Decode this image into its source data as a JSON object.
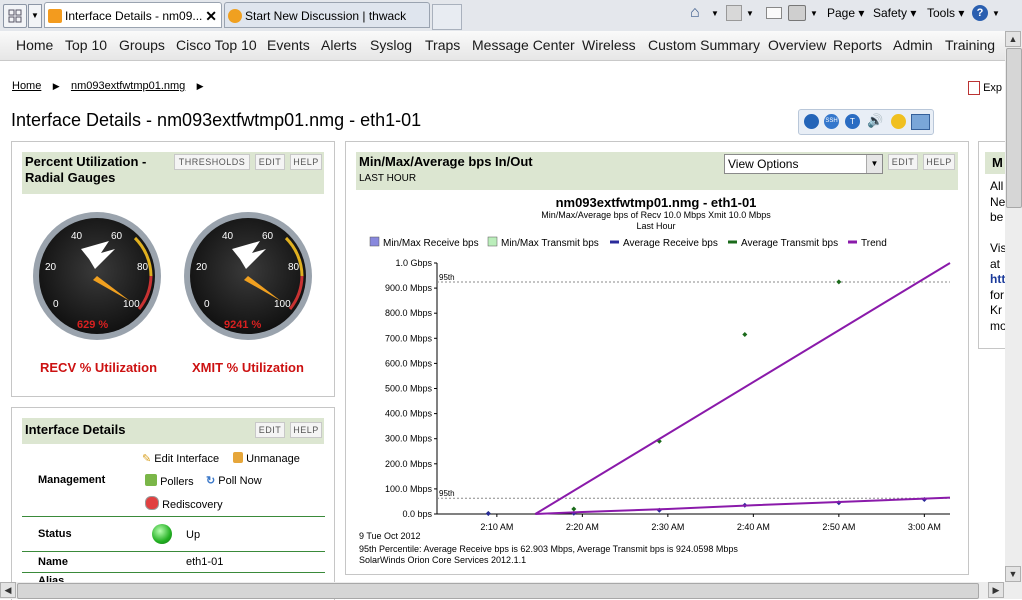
{
  "browser": {
    "tabs": [
      {
        "label": "Interface Details - nm09...",
        "active": true
      },
      {
        "label": "Start New Discussion | thwack",
        "active": false
      }
    ],
    "commands": {
      "page": "Page",
      "safety": "Safety",
      "tools": "Tools"
    }
  },
  "nav": {
    "items": [
      "Home",
      "Top 10",
      "Groups",
      "Cisco Top 10",
      "Events",
      "Alerts",
      "Syslog",
      "Traps",
      "Message Center",
      "Wireless",
      "Custom Summary",
      "Overview",
      "Reports",
      "Admin",
      "Training"
    ]
  },
  "breadcrumb": {
    "home": "Home",
    "node": "nm093extfwtmp01.nmg"
  },
  "export_label": "Exp",
  "page_title": "Interface Details - nm093extfwtmp01.nmg - eth1-01",
  "gauges_panel": {
    "title_line1": "Percent Utilization -",
    "title_line2": "Radial Gauges",
    "btn_thresholds": "THRESHOLDS",
    "btn_edit": "EDIT",
    "btn_help": "HELP",
    "ticks": [
      "0",
      "20",
      "40",
      "60",
      "80",
      "100"
    ],
    "recv": {
      "value_text": "629 %",
      "label": "RECV % Utilization",
      "percent": 629
    },
    "xmit": {
      "value_text": "9241 %",
      "label": "XMIT % Utilization",
      "percent": 9241
    }
  },
  "details_panel": {
    "title": "Interface Details",
    "btn_edit": "EDIT",
    "btn_help": "HELP",
    "management_label": "Management",
    "actions": {
      "edit": "Edit Interface",
      "unmanage": "Unmanage",
      "pollers": "Pollers",
      "poll_now": "Poll Now",
      "rediscovery": "Rediscovery"
    },
    "status_label": "Status",
    "status_value": "Up",
    "name_label": "Name",
    "name_value": "eth1-01",
    "alias_label": "Alias"
  },
  "chart_panel": {
    "title": "Min/Max/Average bps In/Out",
    "subtitle": "LAST HOUR",
    "view_options": "View Options",
    "btn_edit": "EDIT",
    "btn_help": "HELP",
    "chart_title": "nm093extfwtmp01.nmg - eth1-01",
    "chart_subtitle1": "Min/Max/Average bps of   Recv 10.0 Mbps  Xmit 10.0 Mbps",
    "chart_subtitle2": "Last Hour",
    "date_label": "9 Tue Oct 2012",
    "footer1": "95th Percentile: Average Receive bps is 62.903  Mbps, Average Transmit bps is 924.0598  Mbps",
    "footer2": "SolarWinds Orion Core Services 2012.1.1",
    "p95_label": "95th"
  },
  "right_panel": {
    "title": "M",
    "lines": [
      "All",
      "Ne",
      "be",
      "",
      "Vis",
      "at",
      "htt",
      "for",
      "Kr",
      "mo"
    ]
  },
  "chart_data": {
    "type": "line",
    "legend": [
      {
        "name": "Min/Max Receive bps",
        "kind": "box",
        "color": "#8888dd"
      },
      {
        "name": "Min/Max Transmit bps",
        "kind": "box",
        "color": "#bbeebb"
      },
      {
        "name": "Average Receive bps",
        "kind": "line",
        "color": "#2a2a9a"
      },
      {
        "name": "Average Transmit bps",
        "kind": "line",
        "color": "#1a6a1a"
      },
      {
        "name": "Trend",
        "kind": "line",
        "color": "#8a1aaa"
      }
    ],
    "y_ticks": [
      "0.0 bps",
      "100.0 Mbps",
      "200.0 Mbps",
      "300.0 Mbps",
      "400.0 Mbps",
      "500.0 Mbps",
      "600.0 Mbps",
      "700.0 Mbps",
      "800.0 Mbps",
      "900.0 Mbps",
      "1.0 Gbps"
    ],
    "x_ticks": [
      "2:10 AM",
      "2:20 AM",
      "2:30 AM",
      "2:40 AM",
      "2:50 AM",
      "3:00 AM"
    ],
    "ylim_mbps": [
      0,
      1000
    ],
    "xlim_minutes": [
      3,
      63
    ],
    "percentile_95_mbps": {
      "receive": 62.903,
      "transmit": 924.0598
    },
    "series": [
      {
        "name": "Average Transmit bps",
        "color": "#1a6a1a",
        "marker": "point",
        "x": [
          9,
          19,
          29,
          39,
          50
        ],
        "y": [
          2,
          20,
          290,
          715,
          925
        ]
      },
      {
        "name": "Average Receive bps",
        "color": "#2a2a9a",
        "marker": "point",
        "x": [
          9,
          19,
          29,
          39,
          50,
          60
        ],
        "y": [
          2,
          3,
          15,
          35,
          45,
          58
        ]
      },
      {
        "name": "Trend",
        "color": "#8a1aaa",
        "marker": "line",
        "x": [
          14.5,
          63
        ],
        "y": [
          0,
          1000
        ]
      },
      {
        "name": "Trend",
        "color": "#8a1aaa",
        "marker": "line",
        "x": [
          14.5,
          20,
          30,
          40,
          50,
          63
        ],
        "y": [
          0,
          8,
          20,
          35,
          48,
          65
        ]
      }
    ]
  }
}
